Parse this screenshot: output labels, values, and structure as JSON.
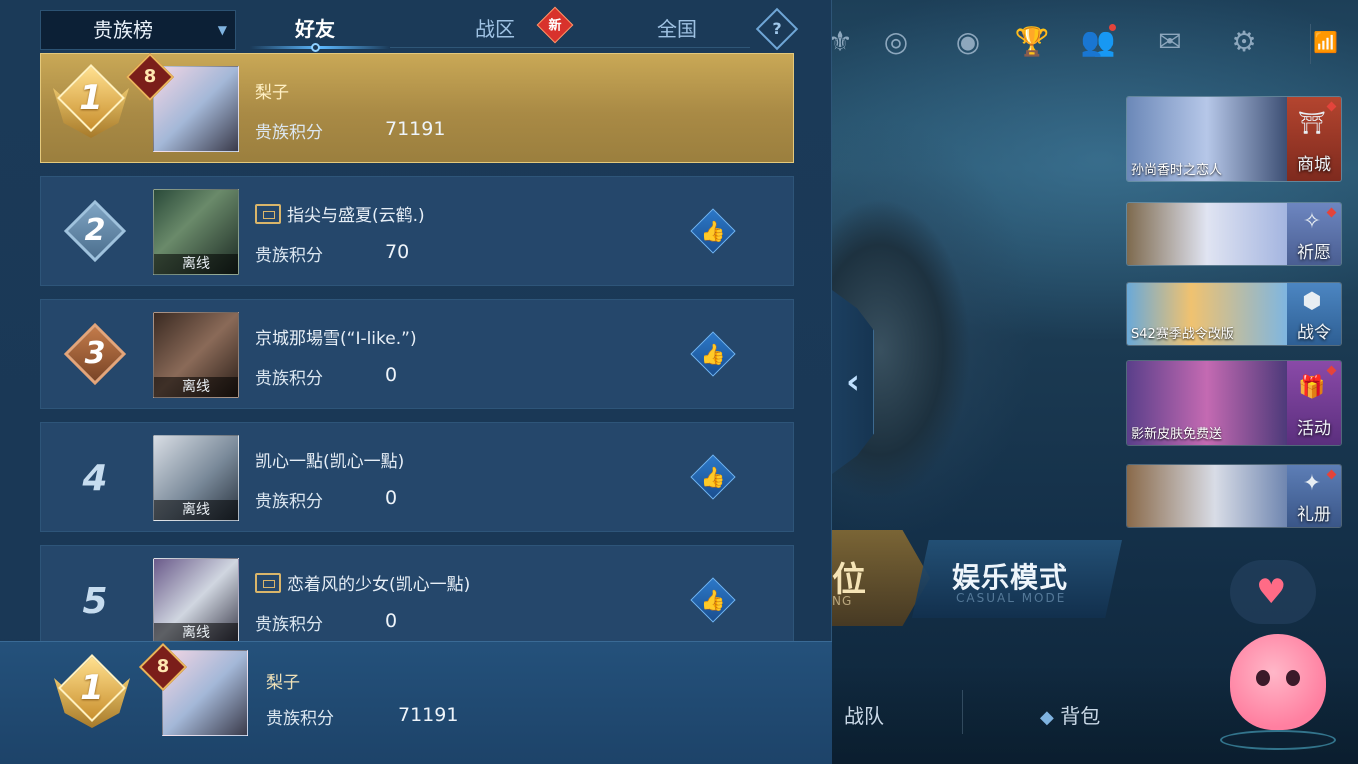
{
  "header": {
    "dropdown_label": "贵族榜",
    "tabs": [
      {
        "label": "好友",
        "active": true
      },
      {
        "label": "战区",
        "badge": "新"
      },
      {
        "label": "全国"
      }
    ],
    "help_symbol": "?"
  },
  "entries": [
    {
      "rank": "1",
      "level": "8",
      "name": "梨子",
      "score_label": "贵族积分",
      "score": "71191",
      "team_icon": false,
      "status": ""
    },
    {
      "rank": "2",
      "name": "指尖与盛夏(云鹤.)",
      "score_label": "贵族积分",
      "score": "70",
      "team_icon": true,
      "status": "离线"
    },
    {
      "rank": "3",
      "name": "京城那場雪(“I-like.”)",
      "score_label": "贵族积分",
      "score": "0",
      "team_icon": false,
      "status": "离线"
    },
    {
      "rank": "4",
      "name": "凯心一點(凯心一點)",
      "score_label": "贵族积分",
      "score": "0",
      "team_icon": false,
      "status": "离线"
    },
    {
      "rank": "5",
      "name": "恋着风的少女(凯心一點)",
      "score_label": "贵族积分",
      "score": "0",
      "team_icon": true,
      "status": "离线"
    }
  ],
  "self": {
    "rank": "1",
    "level": "8",
    "name": "梨子",
    "score_label": "贵族积分",
    "score": "71191"
  },
  "side_cards": [
    {
      "caption": "孙尚香时之恋人",
      "label": "商城",
      "icon": "shop-icon"
    },
    {
      "caption": "",
      "label": "祈愿",
      "icon": "wish-icon"
    },
    {
      "caption": "S42赛季战令改版",
      "label": "战令",
      "icon": "battlepass-icon"
    },
    {
      "caption": "影新皮肤免费送",
      "label": "活动",
      "icon": "gift-icon"
    },
    {
      "caption": "",
      "label": "礼册",
      "icon": "book-icon"
    }
  ],
  "modes": {
    "rank_cn": "位",
    "rank_en": "NG",
    "casual_cn": "娱乐模式",
    "casual_en": "CASUAL MODE"
  },
  "bottom_nav": [
    {
      "label": "战队"
    },
    {
      "label": "背包"
    }
  ],
  "colors": {
    "panel_bg": "#1b3a58",
    "row_bg": "#25476b",
    "gold_row": "#c9a856",
    "accent_blue": "#5cb8ff",
    "new_badge": "#d8322c"
  }
}
